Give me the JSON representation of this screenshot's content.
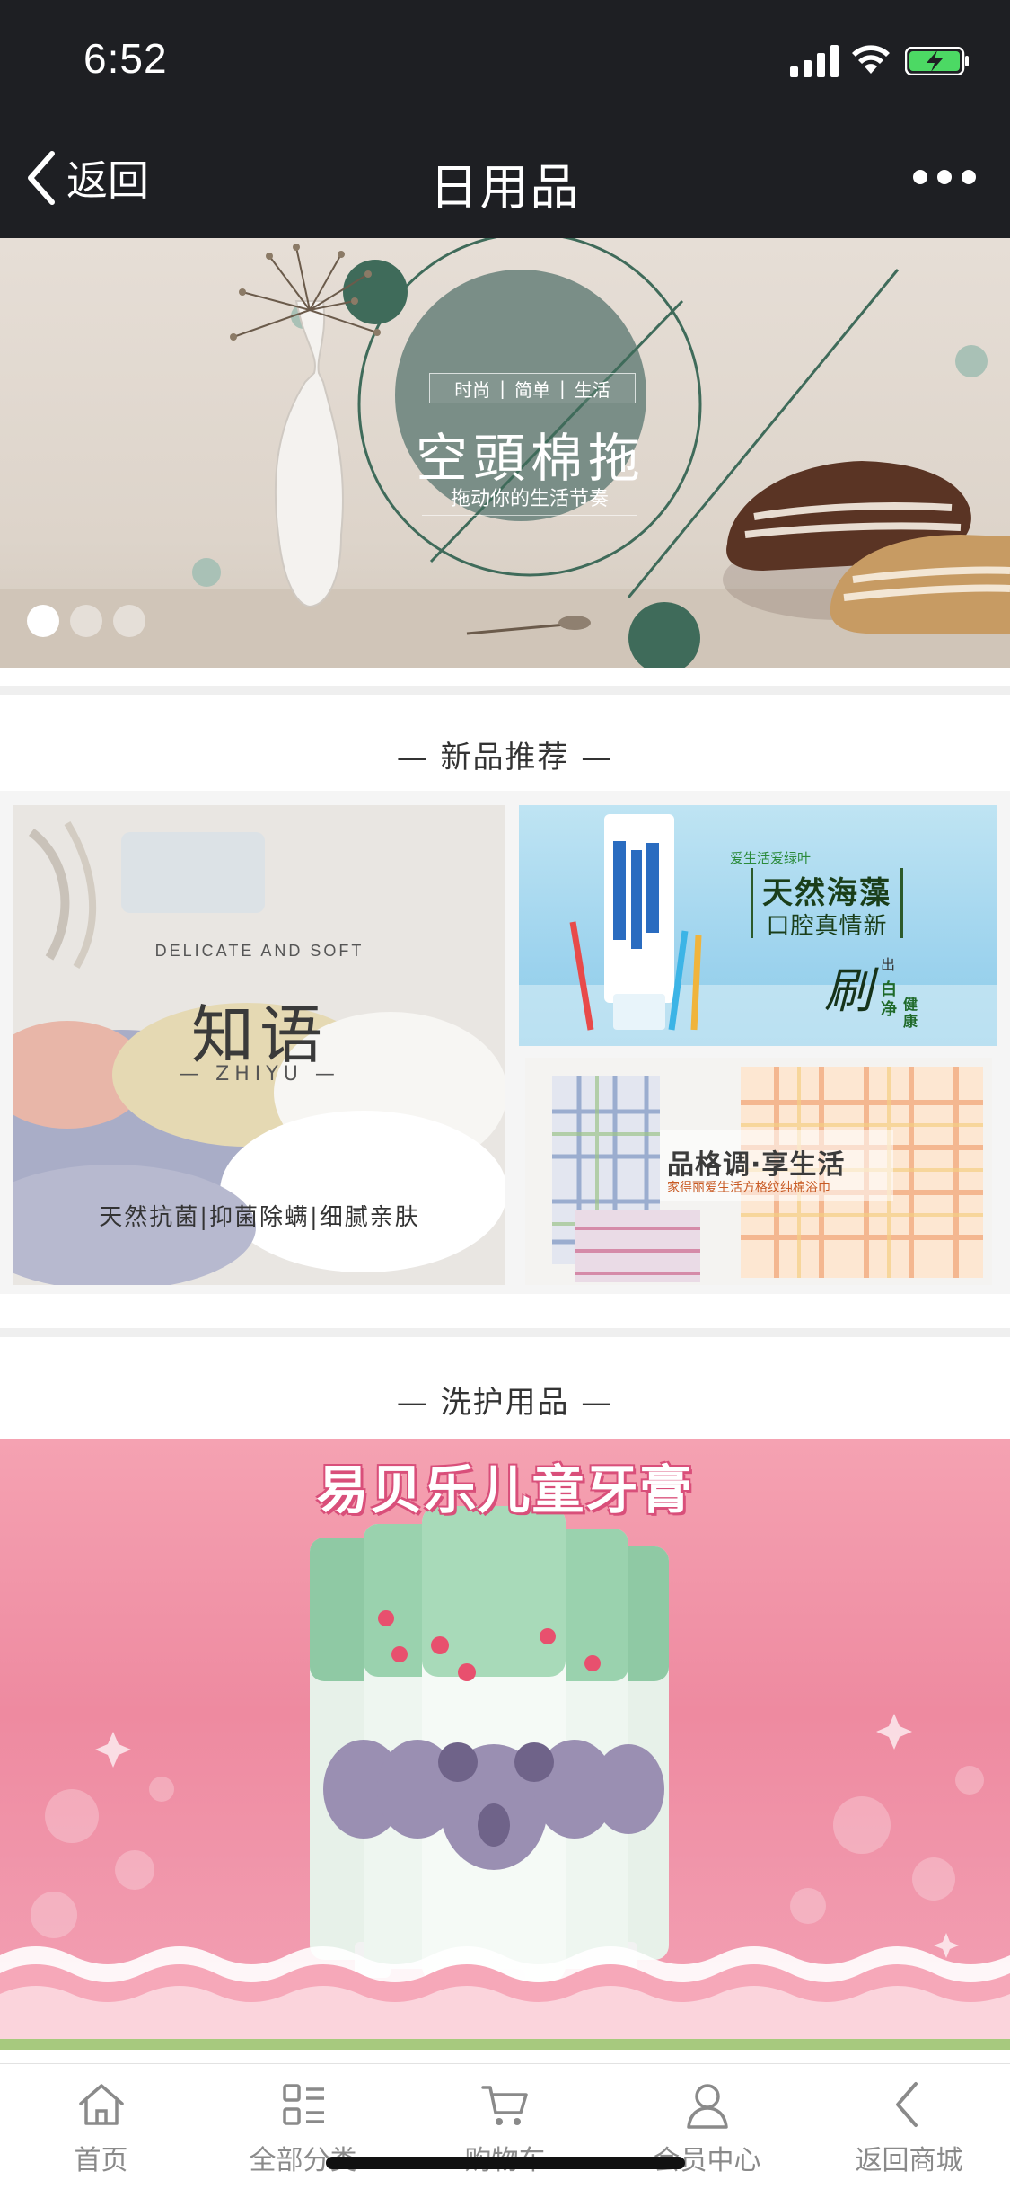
{
  "status_bar": {
    "time": "6:52"
  },
  "nav": {
    "back_label": "返回",
    "title": "日用品"
  },
  "hero_banner": {
    "tagline": [
      "时尚",
      "简单",
      "生活"
    ],
    "headline": "空頭棉拖",
    "subline": "拖动你的生活节奏",
    "slides": 3,
    "active_slide": 1
  },
  "new_products": {
    "title": "— 新品推荐 —",
    "towel_promo": {
      "caption": "DELICATE AND SOFT",
      "title": "知语",
      "romanization": "ZHIYU",
      "features": "天然抗菌|抑菌除螨|细腻亲肤"
    },
    "toothpaste_promo": {
      "brand_line": "爱生活爱绿叶",
      "line1": "天然海藻",
      "line2": "口腔真情新",
      "brush_char": "刷",
      "chars_a": "出",
      "chars_b": "白净",
      "chars_c": "健康"
    },
    "plaid_promo": {
      "headline": "品格调·享生活",
      "subline": "家得丽爱生活方格纹纯棉浴巾"
    }
  },
  "wash_care": {
    "title": "— 洗护用品 —",
    "banner_title": "易贝乐儿童牙膏"
  },
  "tab_bar": {
    "items": [
      {
        "label": "首页",
        "icon": "home-icon"
      },
      {
        "label": "全部分类",
        "icon": "category-grid-icon"
      },
      {
        "label": "购物车",
        "icon": "cart-icon"
      },
      {
        "label": "会员中心",
        "icon": "user-icon"
      },
      {
        "label": "返回商城",
        "icon": "chevron-left-icon"
      }
    ]
  },
  "colors": {
    "nav_bg": "#1e1f23",
    "banner_green": "#3f6b5a",
    "tab_text": "#8a8a8a",
    "wash_pink": "#ee8aa0"
  }
}
